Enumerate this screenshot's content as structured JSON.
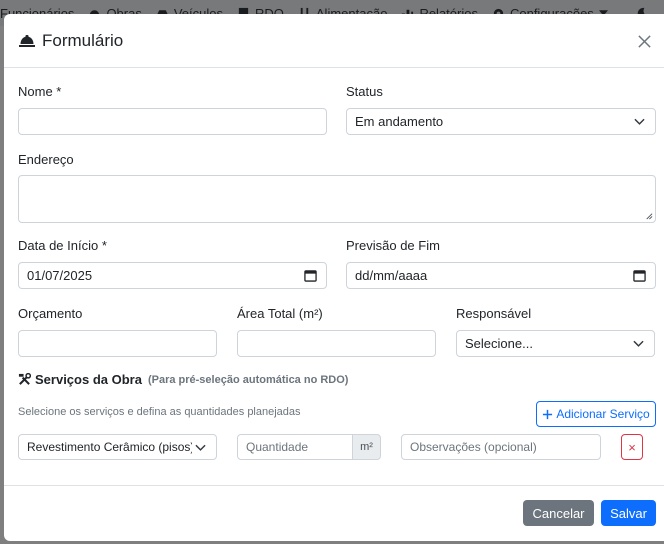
{
  "background_nav": {
    "items": [
      {
        "label": "Funcionários",
        "icon": "users-icon"
      },
      {
        "label": "Obras",
        "icon": "helmet-icon"
      },
      {
        "label": "Veículos",
        "icon": "car-icon"
      },
      {
        "label": "RDO",
        "icon": "document-icon"
      },
      {
        "label": "Alimentação",
        "icon": "utensils-icon"
      },
      {
        "label": "Relatórios",
        "icon": "chart-icon"
      },
      {
        "label": "Configurações",
        "icon": "gear-icon"
      }
    ]
  },
  "modal": {
    "title": "Formulário",
    "fields": {
      "nome": {
        "label": "Nome *",
        "value": ""
      },
      "status": {
        "label": "Status",
        "value": "Em andamento"
      },
      "endereco": {
        "label": "Endereço",
        "value": ""
      },
      "data_inicio": {
        "label": "Data de Início *",
        "value": "01/07/2025"
      },
      "previsao_fim": {
        "label": "Previsão de Fim",
        "value": "dd/mm/aaaa"
      },
      "orcamento": {
        "label": "Orçamento",
        "value": ""
      },
      "area_total": {
        "label": "Área Total (m²)",
        "value": ""
      },
      "responsavel": {
        "label": "Responsável",
        "value": "Selecione..."
      }
    },
    "services": {
      "title": "Serviços da Obra",
      "note": "(Para pré-seleção automática no RDO)",
      "hint": "Selecione os serviços e defina as quantidades planejadas",
      "add_label": "Adicionar Serviço",
      "row": {
        "service": "Revestimento Cerâmico (pisos)",
        "quantity_placeholder": "Quantidade",
        "unit": "m²",
        "notes_placeholder": "Observações (opcional)",
        "remove_label": "×"
      }
    },
    "footer": {
      "cancel_label": "Cancelar",
      "save_label": "Salvar"
    }
  },
  "colors": {
    "primary": "#0d6efd",
    "secondary": "#6c757d",
    "danger": "#dc3545"
  }
}
